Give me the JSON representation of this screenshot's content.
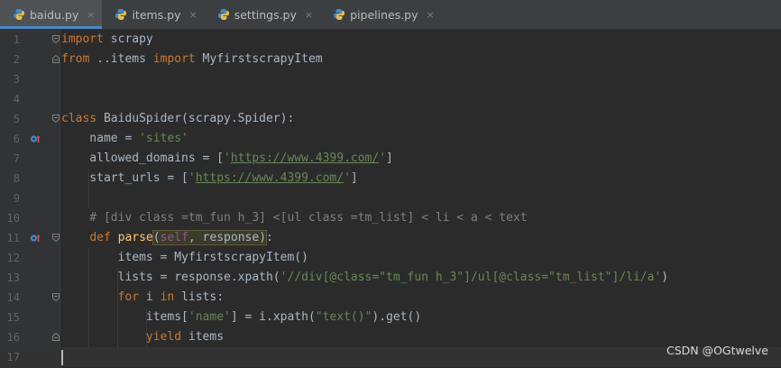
{
  "tabs": [
    {
      "label": "baidu.py",
      "active": true
    },
    {
      "label": "items.py",
      "active": false
    },
    {
      "label": "settings.py",
      "active": false
    },
    {
      "label": "pipelines.py",
      "active": false
    }
  ],
  "tab_close_glyph": "×",
  "line_numbers": [
    "1",
    "2",
    "3",
    "4",
    "5",
    "6",
    "7",
    "8",
    "9",
    "10",
    "11",
    "12",
    "13",
    "14",
    "15",
    "16",
    "17"
  ],
  "code": {
    "l1": {
      "kw": "import",
      "rest": " scrapy"
    },
    "l2": {
      "kw1": "from",
      "mid": " ..items ",
      "kw2": "import",
      "rest": " MyfirstscrapyItem"
    },
    "l5": {
      "kw": "class",
      "rest": " BaiduSpider(scrapy.Spider):"
    },
    "l6": {
      "pre": "    name = ",
      "str": "'sites'"
    },
    "l7": {
      "pre": "    allowed_domains = [",
      "q1": "'",
      "url": "https://www.4399.com/",
      "q2": "'",
      "post": "]"
    },
    "l8": {
      "pre": "    start_urls = [",
      "q1": "'",
      "url": "https://www.4399.com/",
      "q2": "'",
      "post": "]"
    },
    "l10": {
      "comment": "    # [div class =tm_fun h_3] <[ul class =tm_list] < li < a < text"
    },
    "l11": {
      "ind": "    ",
      "kw": "def",
      "name": " parse",
      "open": "(",
      "self": "self",
      "params": ", response",
      "close": ")",
      "colon": ":"
    },
    "l12": {
      "text": "        items = MyfirstscrapyItem()"
    },
    "l13": {
      "pre": "        lists = response.xpath(",
      "str": "'//div[@class=\"tm_fun h_3\"]/ul[@class=\"tm_list\"]/li/a'",
      "post": ")"
    },
    "l14": {
      "ind": "        ",
      "kw1": "for",
      "mid": " i ",
      "kw2": "in",
      "rest": " lists:"
    },
    "l15": {
      "pre": "            items[",
      "str1": "'name'",
      "mid": "] = i.xpath(",
      "str2": "\"text()\"",
      "post": ").get()"
    },
    "l16": {
      "ind": "            ",
      "kw": "yield",
      "rest": " items"
    }
  },
  "icons": {
    "python_file": "python-file-icon",
    "override": "override-method-icon",
    "fold": "fold-marker-icon"
  },
  "colors": {
    "keyword": "#cc7832",
    "string": "#6a8759",
    "comment": "#808080",
    "text": "#a9b7c6",
    "self": "#94558d",
    "background": "#2b2b2b",
    "active_tab_indicator": "#4a88c7"
  },
  "watermark": "CSDN @OGtwelve"
}
